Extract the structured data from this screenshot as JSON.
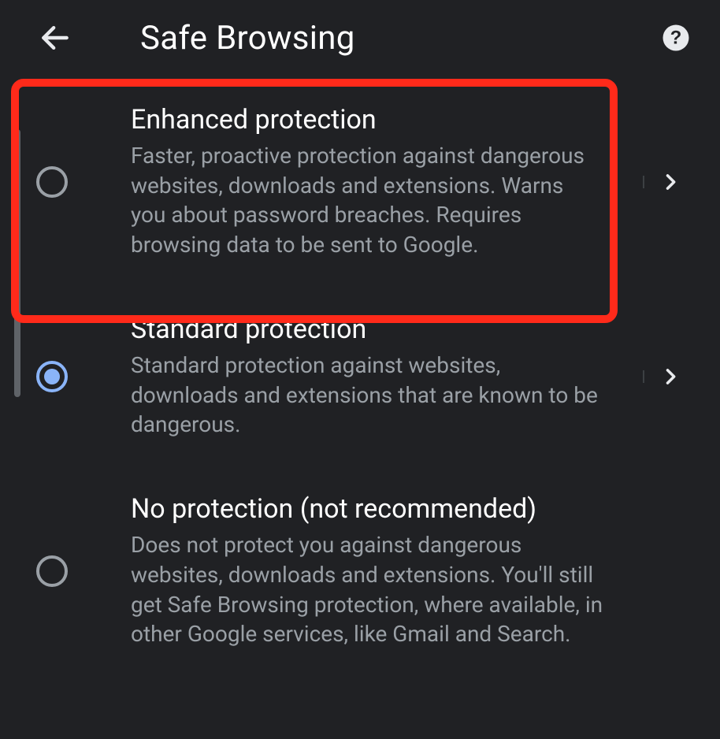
{
  "header": {
    "title": "Safe Browsing"
  },
  "options": [
    {
      "id": "enhanced",
      "title": "Enhanced protection",
      "description": "Faster, proactive protection against dangerous websites, downloads and extensions. Warns you about password breaches. Requires browsing data to be sent to Google.",
      "selected": false,
      "has_chevron": true
    },
    {
      "id": "standard",
      "title": "Standard protection",
      "description": "Standard protection against websites, downloads and extensions that are known to be dangerous.",
      "selected": true,
      "has_chevron": true
    },
    {
      "id": "none",
      "title": "No protection (not recommended)",
      "description": "Does not protect you against dangerous websites, downloads and extensions. You'll still get Safe Browsing protection, where available, in other Google services, like Gmail and Search.",
      "selected": false,
      "has_chevron": false
    }
  ],
  "highlighted_option_index": 0,
  "colors": {
    "background": "#202124",
    "primary_text": "#e8eaed",
    "secondary_text": "#9aa0a6",
    "accent": "#8ab4f8",
    "highlight_border": "#ff2a1a"
  }
}
